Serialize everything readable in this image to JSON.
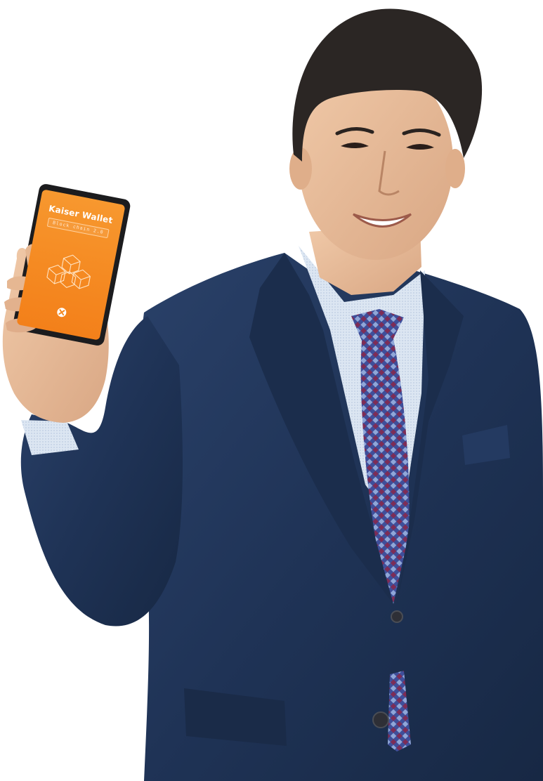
{
  "phone": {
    "app_name": "Kaiser Wallet",
    "subtitle": "Block chain 2.0",
    "brand_color": "#f58a22",
    "logo_icon": "kaiser-x-logo-icon",
    "graphic_icon": "blockchain-cubes-icon"
  },
  "colors": {
    "background": "#ffffff",
    "suit": "#1f3356",
    "shirt": "#d9e3ef",
    "tie": "#3f4f9a",
    "skin": "#e9bf9d",
    "hair": "#2b2624"
  }
}
